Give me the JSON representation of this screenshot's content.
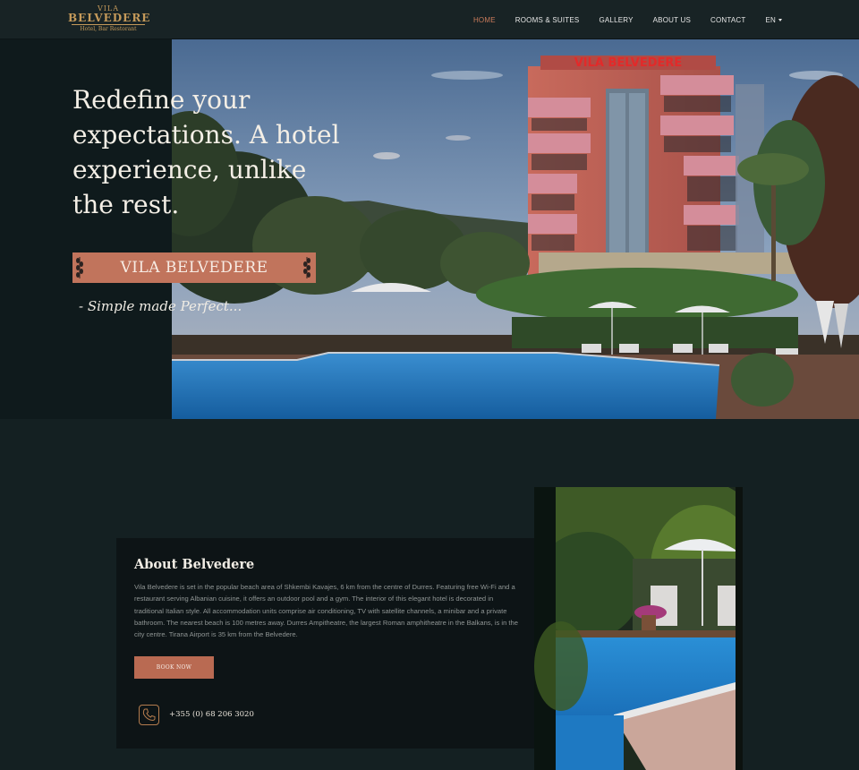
{
  "brand": {
    "logo_line1": "VILA",
    "logo_line2": "BELVEDERE",
    "logo_line3": "Hotel, Bar Restorant"
  },
  "nav": {
    "items": [
      {
        "label": "HOME",
        "active": true
      },
      {
        "label": "ROOMS & SUITES"
      },
      {
        "label": "GALLERY"
      },
      {
        "label": "ABOUT US"
      },
      {
        "label": "CONTACT"
      }
    ],
    "lang": "EN"
  },
  "hero": {
    "title": "Redefine your expectations. A hotel experience, unlike the rest.",
    "banner": "VILA BELVEDERE",
    "tagline": "- Simple made Perfect...",
    "sign": "VILA BELVEDERE"
  },
  "about": {
    "title": "About Belvedere",
    "text": "Vila Belvedere is set in the popular beach area of Shkembi Kavajes, 6 km from the centre of Durres. Featuring free Wi-Fi and a restaurant serving Albanian cuisine, it offers an outdoor pool and a gym. The interior of this elegant hotel is decorated in traditional Italian style. All accommodation units comprise air conditioning, TV with satellite channels, a minibar and a private bathroom. The nearest beach is 100 metres away. Durres Ampitheatre, the largest Roman amphitheatre in the Balkans, is in the city centre. Tirana Airport is 35 km from the Belvedere.",
    "book_label": "BOOK NOW",
    "phone": "+355 (0) 68 206 3020"
  },
  "colors": {
    "accent": "#c1745c",
    "active_nav": "#c87a5a",
    "background": "#142022",
    "card": "#0d1416",
    "gold": "#c59a5a"
  }
}
